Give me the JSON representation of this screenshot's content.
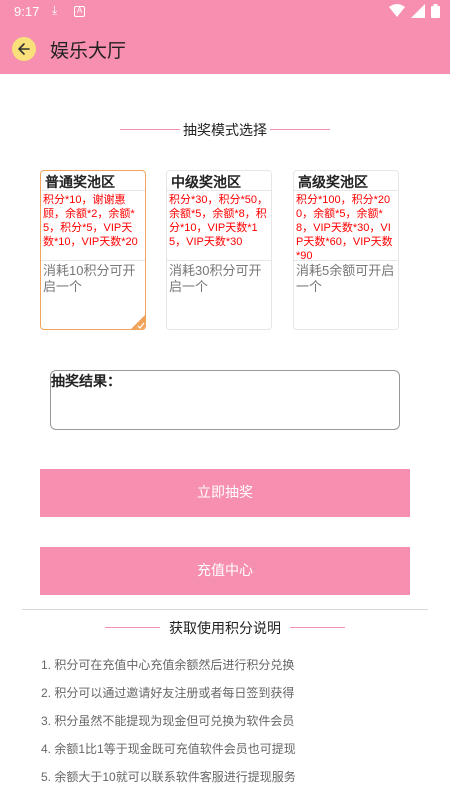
{
  "status": {
    "time": "9:17",
    "download_icon": "download-icon",
    "a_icon": "A"
  },
  "app": {
    "title": "娱乐大厅"
  },
  "mode_section": {
    "title": "抽奖模式选择"
  },
  "pools": [
    {
      "title": "普通奖池区",
      "rewards": "积分*10，谢谢惠顾，余额*2，余额*5，积分*5，VIP天数*10，VIP天数*20",
      "cost": "消耗10积分可开启一个",
      "selected": true
    },
    {
      "title": "中级奖池区",
      "rewards": "积分*30，积分*50，余额*5，余额*8，积分*10，VIP天数*15，VIP天数*30",
      "cost": "消耗30积分可开启一个",
      "selected": false
    },
    {
      "title": "高级奖池区",
      "rewards": "积分*100，积分*200，余额*5，余额*8，VIP天数*30，VIP天数*60，VIP天数*90",
      "cost": "消耗5余额可开启一个",
      "selected": false
    }
  ],
  "result": {
    "label": "抽奖结果："
  },
  "buttons": {
    "draw": "立即抽奖",
    "recharge": "充值中心"
  },
  "instructions": {
    "title": "获取使用积分说明",
    "items": [
      "1. 积分可在充值中心充值余额然后进行积分兑换",
      "2. 积分可以通过邀请好友注册或者每日签到获得",
      "3. 积分虽然不能提现为现金但可兑换为软件会员",
      "4. 余额1比1等于现金既可充值软件会员也可提现",
      "5. 余额大于10就可以联系软件客服进行提现服务"
    ]
  },
  "colors": {
    "accent": "#f78fb0",
    "reward_text": "#ff0000",
    "selected_border": "#f0a45c"
  }
}
